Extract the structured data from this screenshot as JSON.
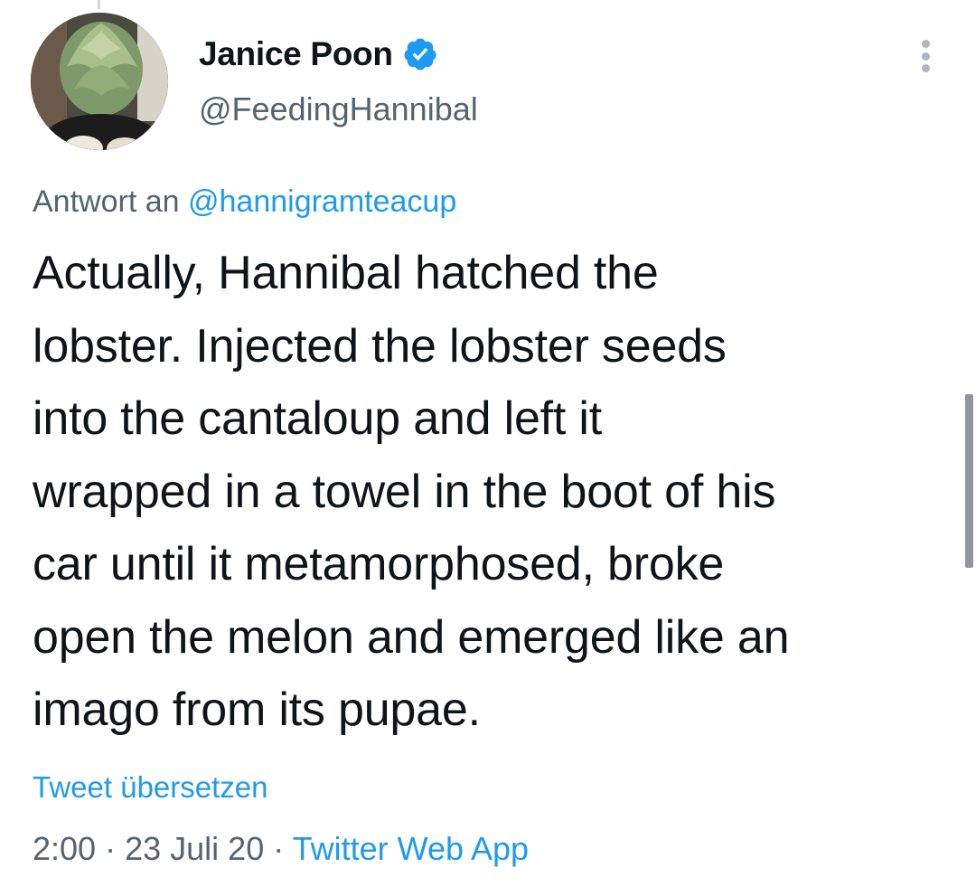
{
  "tweet": {
    "author": {
      "display_name": "Janice Poon",
      "handle": "@FeedingHannibal",
      "verified": true,
      "verified_color": "#1d9bf0"
    },
    "reply_to": {
      "prefix": "Antwort an",
      "mention": "@hannigramteacup"
    },
    "text_lines": [
      "Actually, Hannibal hatched the",
      "lobster. Injected the lobster seeds",
      "into the cantaloup and left it",
      "wrapped in a towel in the boot of his",
      "car until it metamorphosed, broke",
      "open the melon and emerged like an",
      "imago from its pupae."
    ],
    "translate_label": "Tweet übersetzen",
    "time": "2:00",
    "separator": "·",
    "date": "23 Juli 20",
    "source": "Twitter Web App"
  },
  "icons": {
    "verified": "verified-badge-icon",
    "more": "more-options-icon"
  },
  "colors": {
    "link": "#1d9bf0",
    "secondary_text": "#536471",
    "primary_text": "#0f1419"
  }
}
